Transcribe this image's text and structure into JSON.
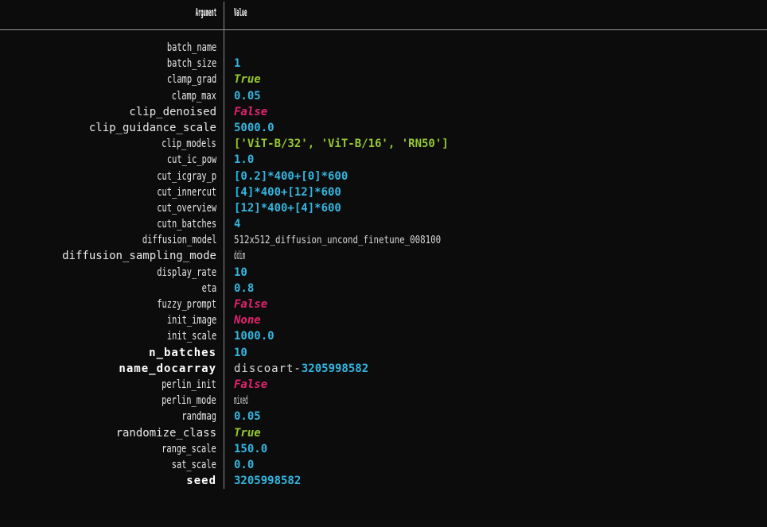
{
  "table": {
    "columns": {
      "argument": "Argument",
      "value": "Value"
    },
    "rows": [
      {
        "arg": "batch_name",
        "val": "",
        "arg_style": "normal",
        "val_style": "empty"
      },
      {
        "arg": "batch_size",
        "val": "1",
        "arg_style": "normal",
        "val_style": "num"
      },
      {
        "arg": "clamp_grad",
        "val": "True",
        "arg_style": "normal",
        "val_style": "true"
      },
      {
        "arg": "clamp_max",
        "val": "0.05",
        "arg_style": "normal",
        "val_style": "num"
      },
      {
        "arg": "clip_denoised",
        "val": "False",
        "arg_style": "wide",
        "val_style": "false"
      },
      {
        "arg": "clip_guidance_scale",
        "val": "5000.0",
        "arg_style": "wide",
        "val_style": "num"
      },
      {
        "arg": "clip_models",
        "val": "['ViT-B/32', 'ViT-B/16', 'RN50']",
        "arg_style": "normal",
        "val_style": "list"
      },
      {
        "arg": "cut_ic_pow",
        "val": "1.0",
        "arg_style": "normal",
        "val_style": "num"
      },
      {
        "arg": "cut_icgray_p",
        "val": "[0.2]*400+[0]*600",
        "arg_style": "normal",
        "val_style": "num"
      },
      {
        "arg": "cut_innercut",
        "val": "[4]*400+[12]*600",
        "arg_style": "normal",
        "val_style": "num"
      },
      {
        "arg": "cut_overview",
        "val": "[12]*400+[4]*600",
        "arg_style": "normal",
        "val_style": "num"
      },
      {
        "arg": "cutn_batches",
        "val": "4",
        "arg_style": "normal",
        "val_style": "num"
      },
      {
        "arg": "diffusion_model",
        "val": "512x512_diffusion_uncond_finetune_008100",
        "arg_style": "normal",
        "val_style": "str-narrow"
      },
      {
        "arg": "diffusion_sampling_mode",
        "val": "ddim",
        "arg_style": "wide",
        "val_style": "plain-narrow"
      },
      {
        "arg": "display_rate",
        "val": "10",
        "arg_style": "normal",
        "val_style": "num"
      },
      {
        "arg": "eta",
        "val": "0.8",
        "arg_style": "normal",
        "val_style": "num"
      },
      {
        "arg": "fuzzy_prompt",
        "val": "False",
        "arg_style": "normal",
        "val_style": "false"
      },
      {
        "arg": "init_image",
        "val": "None",
        "arg_style": "normal",
        "val_style": "none"
      },
      {
        "arg": "init_scale",
        "val": "1000.0",
        "arg_style": "normal",
        "val_style": "num"
      },
      {
        "arg": "n_batches",
        "val": "10",
        "arg_style": "bold",
        "val_style": "num"
      },
      {
        "arg": "name_docarray",
        "val": "discoart-3205998582",
        "arg_style": "bold",
        "val_style": "docarray"
      },
      {
        "arg": "perlin_init",
        "val": "False",
        "arg_style": "normal",
        "val_style": "false"
      },
      {
        "arg": "perlin_mode",
        "val": "mixed",
        "arg_style": "normal",
        "val_style": "plain-narrow"
      },
      {
        "arg": "randmag",
        "val": "0.05",
        "arg_style": "normal",
        "val_style": "num"
      },
      {
        "arg": "randomize_class",
        "val": "True",
        "arg_style": "wide",
        "val_style": "true"
      },
      {
        "arg": "range_scale",
        "val": "150.0",
        "arg_style": "normal",
        "val_style": "num"
      },
      {
        "arg": "sat_scale",
        "val": "0.0",
        "arg_style": "normal",
        "val_style": "num"
      },
      {
        "arg": "seed",
        "val": "3205998582",
        "arg_style": "bold",
        "val_style": "num"
      }
    ]
  },
  "colors": {
    "background": "#0c0c0c",
    "rule": "#9a9a9a",
    "separator": "#8a8a8a",
    "number": "#34b6e0",
    "true": "#96c832",
    "false": "#e0246e",
    "string": "#d8d8d8",
    "list": "#96c832"
  },
  "docarray_parts": {
    "prefix": "discoart-",
    "number": "3205998582"
  }
}
